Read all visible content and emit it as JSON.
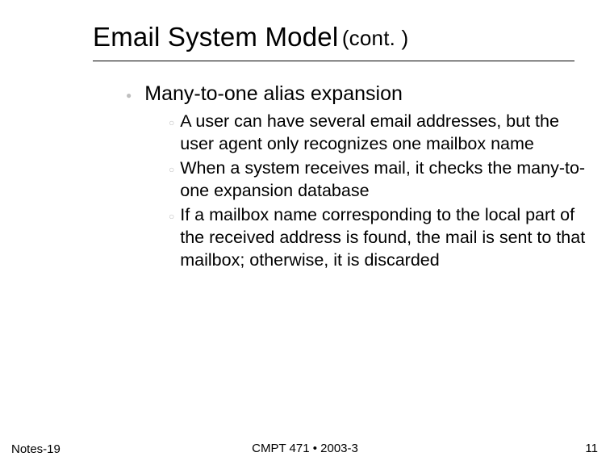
{
  "title": {
    "main": "Email System Model",
    "cont": "(cont. )"
  },
  "body": {
    "l1": "Many-to-one alias expansion",
    "l2": [
      "A user can have several email addresses, but the user agent only recognizes one mailbox name",
      "When a system receives mail, it checks the many-to-one expansion database",
      "If a mailbox name corresponding to the local part of the received address is found, the mail is sent to that mailbox; otherwise, it is discarded"
    ]
  },
  "footer": {
    "left": "Notes-19",
    "center": "CMPT 471 • 2003-3",
    "right": "11"
  }
}
